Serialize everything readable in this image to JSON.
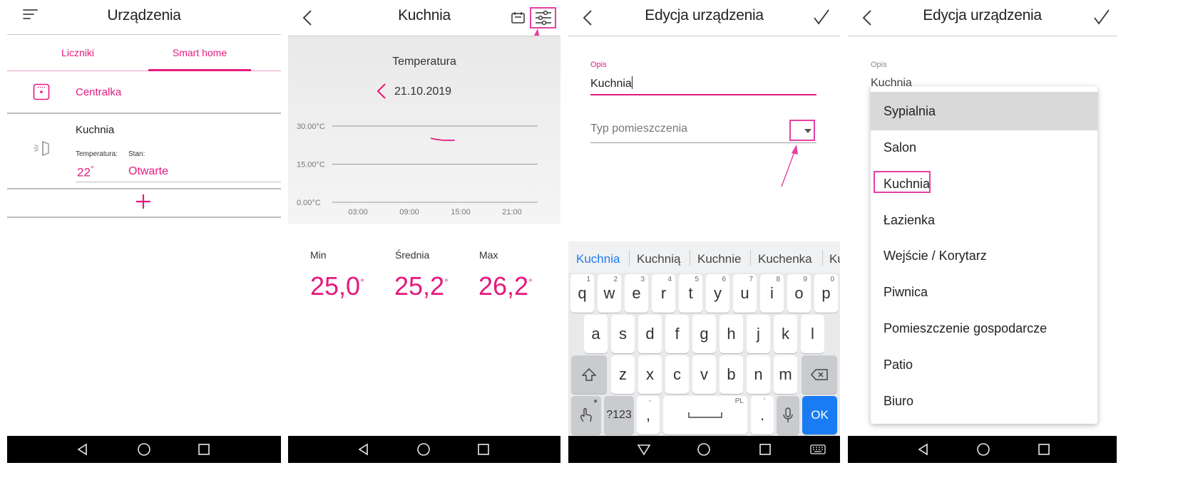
{
  "colors": {
    "accent": "#e5197e",
    "keyboard_bg": "#e8e9eb",
    "ok_key": "#1a7cf5",
    "chart_panel": "#eeeeee",
    "highlight_box": "#e63fa4",
    "selected_row": "#d9d9d9"
  },
  "screen1": {
    "title": "Urządzenia",
    "tabs": [
      {
        "label": "Liczniki"
      },
      {
        "label": "Smart home"
      }
    ],
    "active_tab": "Smart home",
    "hub": {
      "label": "Centralka",
      "icon": "hub-icon"
    },
    "device": {
      "name": "Kuchnia",
      "icon": "door-sensor-icon",
      "temp_label": "Temperatura:",
      "temp_value": "22",
      "temp_unit": "°",
      "state_label": "Stan:",
      "state_value": "Otwarte"
    },
    "add_icon": "plus-icon"
  },
  "screen2": {
    "title": "Kuchnia",
    "chart_data": {
      "type": "line",
      "title": "Temperatura",
      "date": "21.10.2019",
      "y_ticks": [
        "30.00°C",
        "15.00°C",
        "0.00°C"
      ],
      "x_ticks": [
        "03:00",
        "09:00",
        "15:00",
        "21:00"
      ],
      "ylim": [
        0,
        30
      ],
      "xlim": [
        0,
        24
      ],
      "series": [
        {
          "x": [
            11.5,
            12.2,
            13.0,
            14.3
          ],
          "values": [
            25.2,
            24.7,
            24.4,
            24.4
          ]
        }
      ]
    },
    "stats": [
      {
        "label": "Min",
        "value": "25,0",
        "unit": "°"
      },
      {
        "label": "Średnia",
        "value": "25,2",
        "unit": "°"
      },
      {
        "label": "Max",
        "value": "26,2",
        "unit": "°"
      }
    ]
  },
  "screen3": {
    "title": "Edycja urządzenia",
    "field_label": "Opis",
    "field_value": "Kuchnia",
    "select_placeholder": "Typ pomieszczenia",
    "suggestions": [
      "Kuchnia",
      "Kuchnią",
      "Kuchnie",
      "Kuchenka",
      "Ku"
    ],
    "keys_row1": [
      {
        "k": "q",
        "n": "1"
      },
      {
        "k": "w",
        "n": "2"
      },
      {
        "k": "e",
        "n": "3"
      },
      {
        "k": "r",
        "n": "4"
      },
      {
        "k": "t",
        "n": "5"
      },
      {
        "k": "y",
        "n": "6"
      },
      {
        "k": "u",
        "n": "7"
      },
      {
        "k": "i",
        "n": "8"
      },
      {
        "k": "o",
        "n": "9"
      },
      {
        "k": "p",
        "n": "0"
      }
    ],
    "keys_row2": [
      "a",
      "s",
      "d",
      "f",
      "g",
      "h",
      "j",
      "k",
      "l"
    ],
    "keys_row3": [
      "z",
      "x",
      "c",
      "v",
      "b",
      "n",
      "m"
    ],
    "key_123": "?123",
    "key_comma": ",",
    "key_comma_hint": "-",
    "key_space_hint": "PL",
    "key_period": ".",
    "key_period_hint": "'",
    "key_ok": "OK"
  },
  "screen4": {
    "title": "Edycja urządzenia",
    "field_label": "Opis",
    "field_value": "Kuchnia",
    "options": [
      "Sypialnia",
      "Salon",
      "Kuchnia",
      "Łazienka",
      "Wejście / Korytarz",
      "Piwnica",
      "Pomieszczenie gospodarcze",
      "Patio",
      "Biuro"
    ],
    "highlighted_option": "Sypialnia",
    "boxed_option": "Kuchnia"
  }
}
